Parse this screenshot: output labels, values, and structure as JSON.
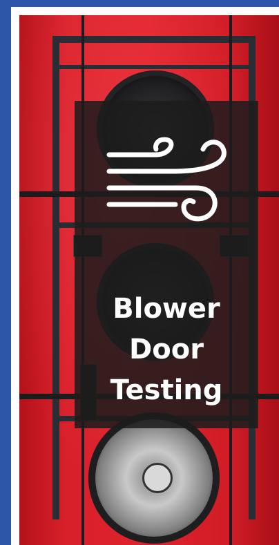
{
  "banner": {
    "title_lines": [
      "Blower",
      "Door",
      "Testing"
    ],
    "icon": "wind-icon"
  },
  "colors": {
    "background": "#2d56a6",
    "card": "#ffffff",
    "photo_red": "#d8202a",
    "overlay": "#1c1c1c",
    "text": "#ffffff"
  }
}
